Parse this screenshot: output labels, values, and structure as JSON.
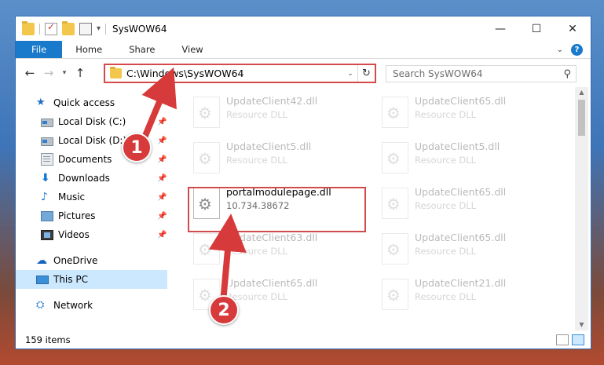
{
  "window": {
    "title": "SysWOW64",
    "controls": {
      "minimize": "—",
      "maximize": "☐",
      "close": "✕"
    }
  },
  "ribbon": {
    "tabs": [
      "File",
      "Home",
      "Share",
      "View"
    ],
    "collapse_glyph": "⌄",
    "help_glyph": "?"
  },
  "nav": {
    "back": "←",
    "forward": "→",
    "recent": "▾",
    "up": "↑",
    "address": "C:\\Windows\\SysWOW64",
    "address_dropdown": "⌄",
    "refresh": "↻",
    "search_placeholder": "Search SysWOW64",
    "search_glyph": "⚲"
  },
  "sidebar": {
    "items": [
      {
        "label": "Quick access",
        "icon": "star-icon",
        "pinned": false
      },
      {
        "label": "Local Disk (C:)",
        "icon": "local-disk-icon",
        "pinned": true
      },
      {
        "label": "Local Disk (D:)",
        "icon": "local-disk-icon",
        "pinned": true
      },
      {
        "label": "Documents",
        "icon": "documents-icon",
        "pinned": true
      },
      {
        "label": "Downloads",
        "icon": "downloads-icon",
        "pinned": true
      },
      {
        "label": "Music",
        "icon": "music-icon",
        "pinned": true
      },
      {
        "label": "Pictures",
        "icon": "pictures-icon",
        "pinned": true
      },
      {
        "label": "Videos",
        "icon": "videos-icon",
        "pinned": true
      },
      {
        "label": "OneDrive",
        "icon": "onedrive-icon",
        "pinned": false
      },
      {
        "label": "This PC",
        "icon": "this-pc-icon",
        "pinned": false,
        "selected": true
      },
      {
        "label": "Network",
        "icon": "network-icon",
        "pinned": false
      }
    ],
    "pin_glyph": "📌",
    "glyphs": {
      "star": "★",
      "down": "⬇",
      "music": "♪",
      "cloud": "☁",
      "net": "⛭"
    }
  },
  "files": [
    {
      "name": "UpdateClient42.dll",
      "sub": "Resource DLL",
      "faded": true
    },
    {
      "name": "UpdateClient65.dll",
      "sub": "Resource DLL",
      "faded": true
    },
    {
      "name": "UpdateClient5.dll",
      "sub": "Resource DLL",
      "faded": true
    },
    {
      "name": "UpdateClient5.dll",
      "sub": "Resource DLL",
      "faded": true
    },
    {
      "name": "portalmodulepage.dll",
      "sub": "10.734.38672",
      "faded": false
    },
    {
      "name": "UpdateClient65.dll",
      "sub": "Resource DLL",
      "faded": true
    },
    {
      "name": "UpdateClient63.dll",
      "sub": "Resource DLL",
      "faded": true
    },
    {
      "name": "UpdateClient65.dll",
      "sub": "Resource DLL",
      "faded": true
    },
    {
      "name": "UpdateClient65.dll",
      "sub": "Resource DLL",
      "faded": true
    },
    {
      "name": "UpdateClient21.dll",
      "sub": "Resource DLL",
      "faded": true
    }
  ],
  "status": {
    "item_count": "159 items"
  },
  "scroll_glyphs": {
    "up": "▲",
    "down": "▼"
  },
  "annotations": {
    "callout_1": "1",
    "callout_2": "2",
    "highlight_color": "#d24a4a"
  },
  "colors": {
    "accent": "#1979ca",
    "selection": "#cce8ff",
    "callout": "#d63a3a"
  }
}
